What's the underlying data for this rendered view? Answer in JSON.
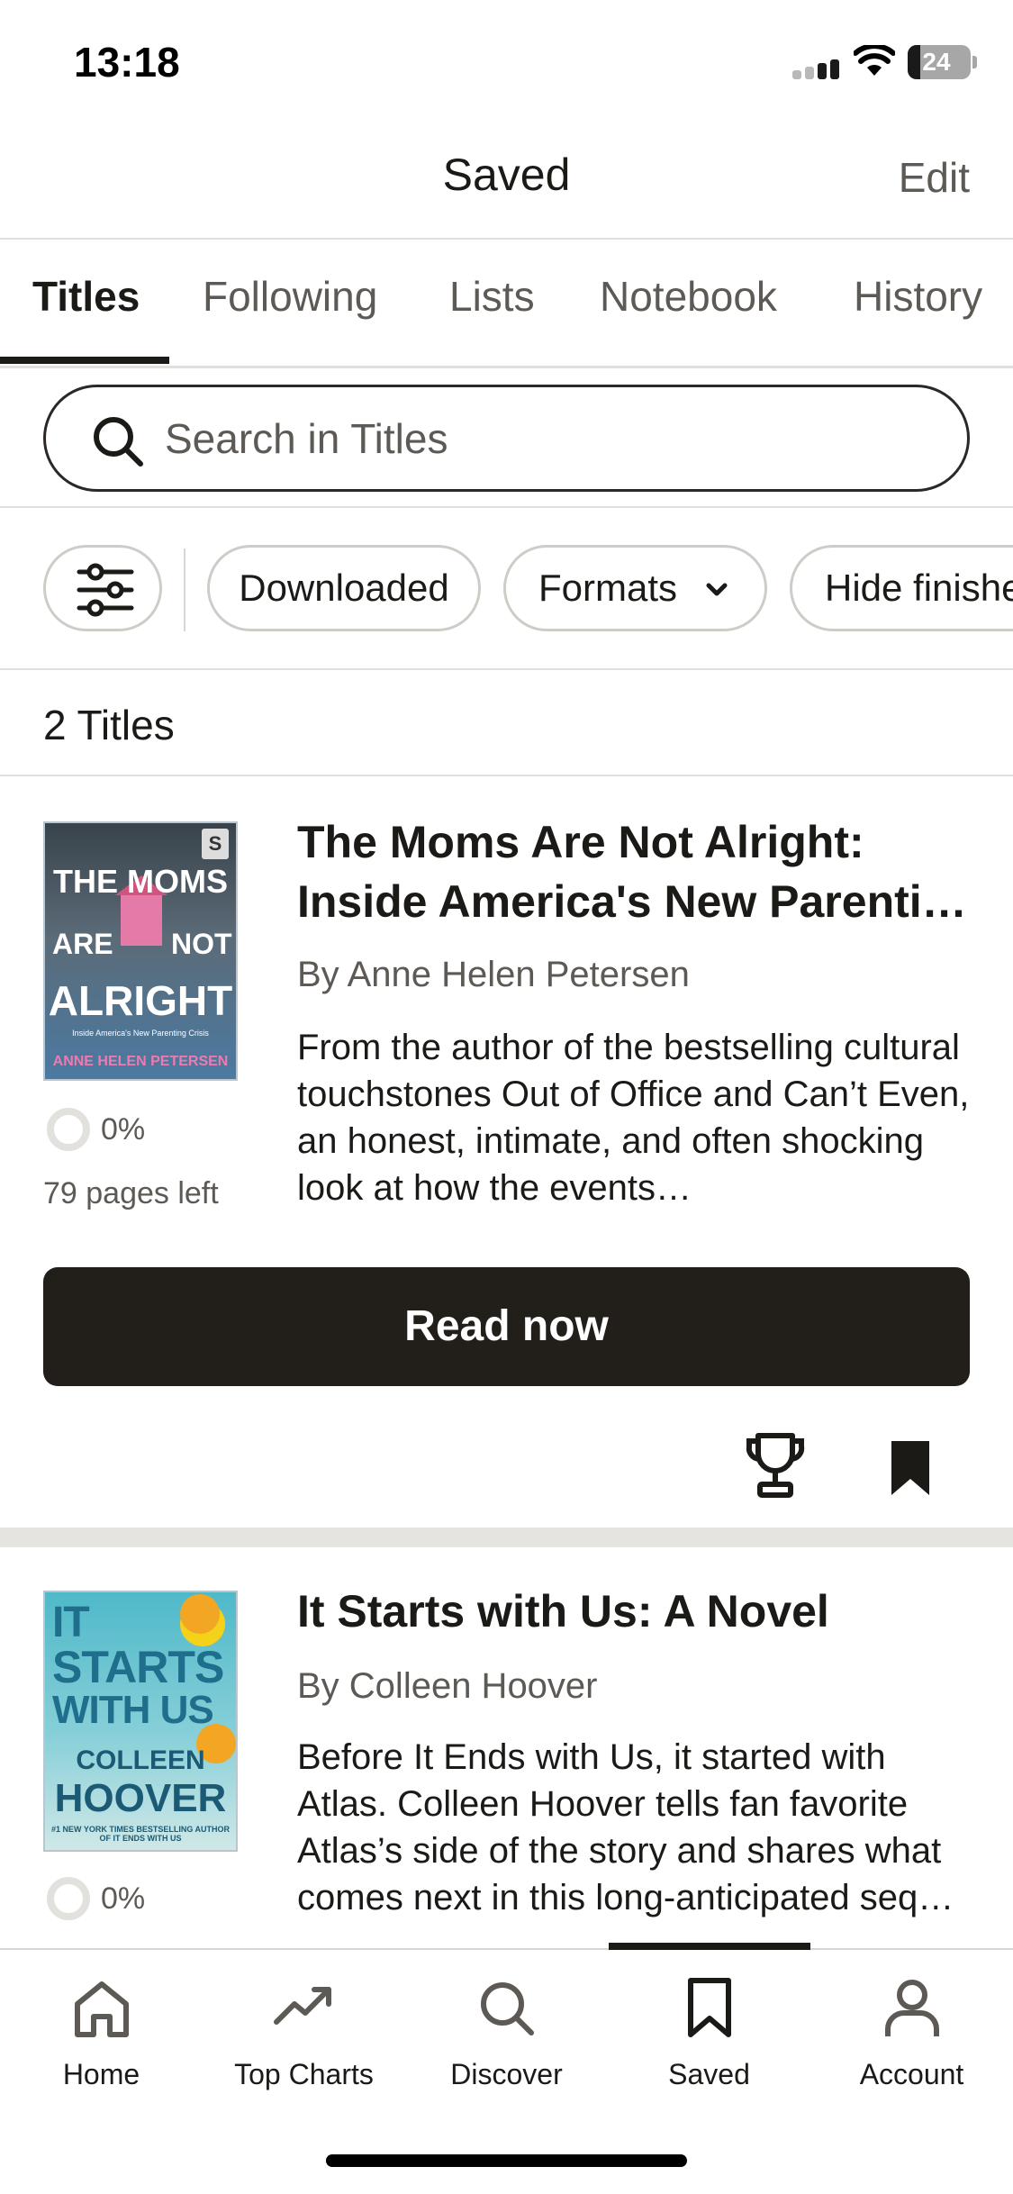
{
  "status_bar": {
    "time": "13:18",
    "battery": "24"
  },
  "header": {
    "title": "Saved",
    "edit_label": "Edit"
  },
  "tabs": [
    {
      "label": "Titles",
      "active": true
    },
    {
      "label": "Following",
      "active": false
    },
    {
      "label": "Lists",
      "active": false
    },
    {
      "label": "Notebook",
      "active": false
    },
    {
      "label": "History",
      "active": false
    }
  ],
  "search": {
    "placeholder": "Search in Titles",
    "value": ""
  },
  "filters": {
    "settings_icon": "sliders-icon",
    "chips": [
      {
        "label": "Downloaded"
      },
      {
        "label": "Formats",
        "icon": "chevron-down-icon"
      },
      {
        "label": "Hide finishe"
      }
    ]
  },
  "list": {
    "count_label": "2 Titles",
    "books": [
      {
        "title": "The Moms Are Not Alright: Inside America's New Parenti…",
        "author": "By Anne Helen Petersen",
        "description": "From the author of the bestselling cultural touchstones Out of Office and Can’t Even, an honest, intimate, and often shocking look at how the events…",
        "progress": "0%",
        "pages_left": "79 pages left",
        "read_button": "Read now",
        "cover": {
          "badge": "S",
          "line1": "THE MOMS",
          "line2a": "ARE",
          "line2b": "NOT",
          "line3": "ALRIGHT",
          "subtitle": "Inside America's New Parenting Crisis",
          "author": "ANNE HELEN PETERSEN"
        }
      },
      {
        "title": "It Starts with Us: A Novel",
        "author": "By Colleen Hoover",
        "description": "Before It Ends with Us, it started with Atlas. Colleen Hoover tells fan favorite Atlas’s side of the story and shares what comes next in this long-anticipated seq…",
        "progress": "0%",
        "cover": {
          "line1": "IT",
          "line2": "STARTS",
          "line3": "WITH US",
          "author1": "COLLEEN",
          "author2": "HOOVER",
          "tagline": "#1 NEW YORK TIMES BESTSELLING AUTHOR OF IT ENDS WITH US"
        }
      }
    ]
  },
  "bottom_nav": [
    {
      "label": "Home",
      "icon": "home-icon"
    },
    {
      "label": "Top Charts",
      "icon": "trending-icon"
    },
    {
      "label": "Discover",
      "icon": "search-icon"
    },
    {
      "label": "Saved",
      "icon": "bookmark-icon",
      "active": true
    },
    {
      "label": "Account",
      "icon": "person-icon"
    }
  ],
  "colors": {
    "ink": "#1c1a17",
    "muted": "#5d5955",
    "divider": "#e1dfdc",
    "button": "#221f1b"
  }
}
